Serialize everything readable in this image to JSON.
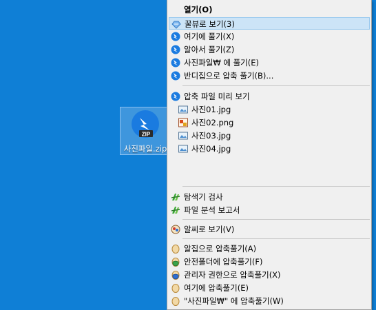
{
  "desktop": {
    "file_label": "사진파일.zip",
    "badge_text": "ZIP"
  },
  "menu": {
    "open": "열기(O)",
    "items_top": [
      {
        "label": "꿀뷰로 보기(3)",
        "icon": "honeyview-icon"
      },
      {
        "label": "여기에 풀기(X)",
        "icon": "bandizip-icon"
      },
      {
        "label": "알아서 풀기(Z)",
        "icon": "bandizip-icon"
      },
      {
        "label": "사진파일₩ 에 풀기(E)",
        "icon": "bandizip-icon"
      },
      {
        "label": "반디집으로 압축 풀기(B)...",
        "icon": "bandizip-icon"
      }
    ],
    "preview_label": "압축 파일 미리 보기",
    "preview_files": [
      {
        "name": "사진01.jpg",
        "icon": "jpg-file-icon"
      },
      {
        "name": "사진02.png",
        "icon": "png-file-icon"
      },
      {
        "name": "사진03.jpg",
        "icon": "jpg-file-icon"
      },
      {
        "name": "사진04.jpg",
        "icon": "jpg-file-icon"
      }
    ],
    "explorer_scan": "탐색기 검사",
    "file_report": "파일 분석 보고서",
    "alsee_view": "알씨로 보기(V)",
    "alzip_items": [
      "알집으로 압축풀기(A)",
      "안전폴더에 압축풀기(F)",
      "관리자 권한으로 압축풀기(X)",
      "여기에 압축풀기(E)",
      "\"사진파일₩\" 에 압축풀기(W)"
    ]
  }
}
